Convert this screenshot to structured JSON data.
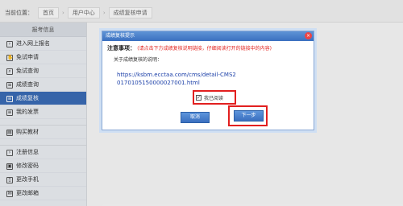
{
  "breadcrumb": {
    "label": "当前位置：",
    "items": [
      "首页",
      "用户中心",
      "成绩复核申请"
    ],
    "separator": "›"
  },
  "sidebar": {
    "header": "报考信息",
    "items": [
      {
        "label": "进入网上报名",
        "icon": "arrow-right-icon"
      },
      {
        "label": "免试申请",
        "icon": "hand-icon"
      },
      {
        "label": "免试查询",
        "icon": "search-icon"
      },
      {
        "label": "成绩查询",
        "icon": "document-icon"
      },
      {
        "label": "成绩复核",
        "icon": "document-icon",
        "active": true
      },
      {
        "label": "我的发票",
        "icon": "receipt-icon"
      }
    ],
    "items2": [
      {
        "label": "购买教材",
        "icon": "book-icon"
      }
    ],
    "items3": [
      {
        "label": "注册信息",
        "icon": "arrow-right-icon"
      },
      {
        "label": "修改密码",
        "icon": "lock-icon"
      },
      {
        "label": "更改手机",
        "icon": "phone-icon"
      },
      {
        "label": "更改邮箱",
        "icon": "mail-icon"
      }
    ]
  },
  "dialog": {
    "title": "成绩复核提示",
    "close_glyph": "×",
    "note_title": "注意事项：",
    "note_red": "(请点击下方成绩复核说明链接，仔细阅读打开的链接中的内容)",
    "desc": "关于成绩复核的说明：",
    "link_text": "https://ksbm.ecctaa.com/cms/detail-CMS20170105150000027001.html",
    "checkbox_label": "我已阅读",
    "checkbox_checked": true,
    "cancel_label": "取消",
    "next_label": "下一步"
  },
  "colors": {
    "accent": "#3a6bb4",
    "highlight_red": "#e21f1f",
    "link": "#1b3fa8"
  }
}
